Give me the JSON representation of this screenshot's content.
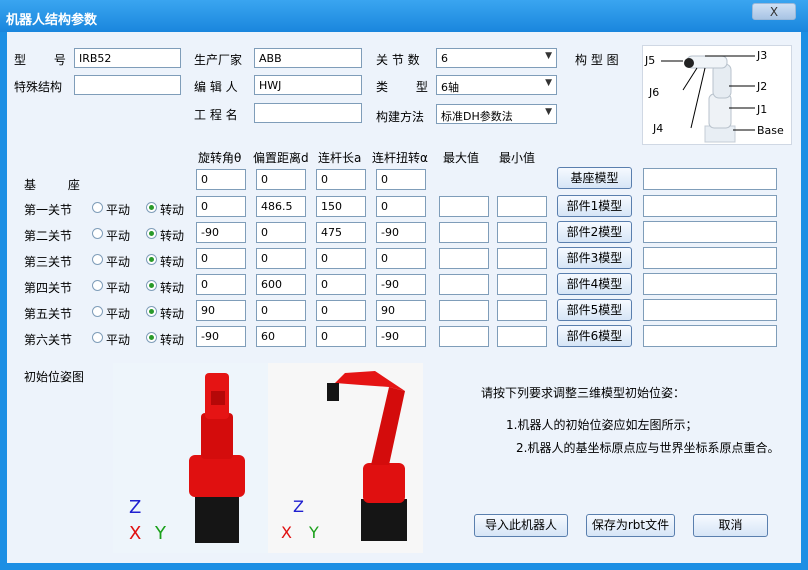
{
  "window": {
    "title": "机器人结构参数",
    "close": "X"
  },
  "fields": {
    "model_label": "型 号",
    "model_value": "IRB52",
    "manufacturer_label": "生产厂家",
    "manufacturer_value": "ABB",
    "joints_label": "关 节 数",
    "joints_value": "6",
    "special_label": "特殊结构",
    "special_value": "",
    "editor_label": "编 辑 人",
    "editor_value": "HWJ",
    "type_label": "类 型",
    "type_value": "6轴",
    "project_label": "工 程 名",
    "project_value": "",
    "method_label": "构建方法",
    "method_value": "标准DH参数法",
    "diagram_label": "构 型 图"
  },
  "diagram_labels": {
    "j3": "J3",
    "j5": "J5",
    "j2": "J2",
    "j6": "J6",
    "j1": "J1",
    "j4": "J4",
    "base": "Base"
  },
  "table": {
    "headers": [
      "旋转角θ",
      "偏置距离d",
      "连杆长a",
      "连杆扭转α",
      "最大值",
      "最小值"
    ],
    "base_label": "基 座",
    "base_values": [
      "0",
      "0",
      "0",
      "0"
    ],
    "base_button": "基座模型",
    "radio_translate": "平动",
    "radio_rotate": "转动",
    "rows": [
      {
        "label": "第一关节",
        "values": [
          "0",
          "486.5",
          "150",
          "0"
        ],
        "button": "部件1模型"
      },
      {
        "label": "第二关节",
        "values": [
          "-90",
          "0",
          "475",
          "-90"
        ],
        "button": "部件2模型"
      },
      {
        "label": "第三关节",
        "values": [
          "0",
          "0",
          "0",
          "0"
        ],
        "button": "部件3模型"
      },
      {
        "label": "第四关节",
        "values": [
          "0",
          "600",
          "0",
          "-90"
        ],
        "button": "部件4模型"
      },
      {
        "label": "第五关节",
        "values": [
          "90",
          "0",
          "0",
          "90"
        ],
        "button": "部件5模型"
      },
      {
        "label": "第六关节",
        "values": [
          "-90",
          "60",
          "0",
          "-90"
        ],
        "button": "部件6模型"
      }
    ]
  },
  "pose": {
    "label": "初始位姿图",
    "axis_z": "Z",
    "axis_x": "X",
    "axis_y": "Y"
  },
  "instructions": {
    "heading": "请按下列要求调整三维模型初始位姿：",
    "item1": "1.机器人的初始位姿应如左图所示；",
    "item2": "2.机器人的基坐标原点应与世界坐标系原点重合。"
  },
  "buttons": {
    "import": "导入此机器人",
    "save": "保存为rbt文件",
    "cancel": "取消"
  },
  "colors": {
    "titlebar": "#1a86dd",
    "robot": "#e01010",
    "panel": "#edf3fb"
  }
}
